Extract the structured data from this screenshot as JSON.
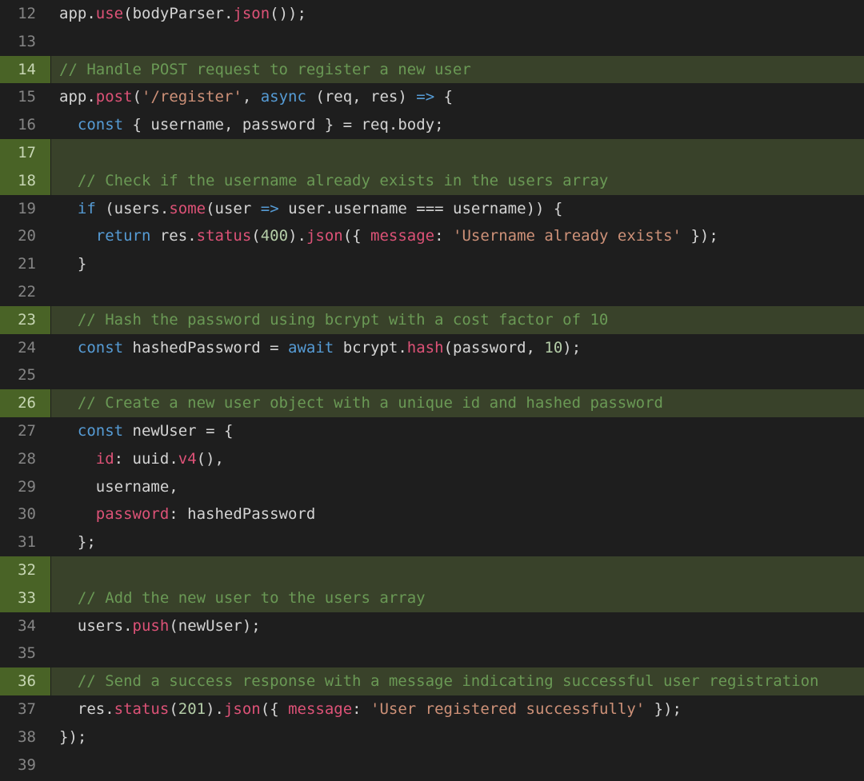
{
  "startLine": 12,
  "highlightLines": [
    14,
    17,
    18,
    23,
    26,
    32,
    33,
    36
  ],
  "lines": [
    {
      "n": 12,
      "tokens": [
        {
          "t": "app",
          "c": "tk-ident"
        },
        {
          "t": ".",
          "c": "tk-punc"
        },
        {
          "t": "use",
          "c": "tk-method"
        },
        {
          "t": "(",
          "c": "tk-punc"
        },
        {
          "t": "bodyParser",
          "c": "tk-ident"
        },
        {
          "t": ".",
          "c": "tk-punc"
        },
        {
          "t": "json",
          "c": "tk-method"
        },
        {
          "t": "());",
          "c": "tk-punc"
        }
      ]
    },
    {
      "n": 13,
      "tokens": []
    },
    {
      "n": 14,
      "tokens": [
        {
          "t": "// Handle POST request to register a new user",
          "c": "tk-comment"
        }
      ]
    },
    {
      "n": 15,
      "tokens": [
        {
          "t": "app",
          "c": "tk-ident"
        },
        {
          "t": ".",
          "c": "tk-punc"
        },
        {
          "t": "post",
          "c": "tk-method"
        },
        {
          "t": "(",
          "c": "tk-punc"
        },
        {
          "t": "'/register'",
          "c": "tk-string"
        },
        {
          "t": ", ",
          "c": "tk-punc"
        },
        {
          "t": "async",
          "c": "tk-kw"
        },
        {
          "t": " (",
          "c": "tk-punc"
        },
        {
          "t": "req",
          "c": "tk-ident"
        },
        {
          "t": ", ",
          "c": "tk-punc"
        },
        {
          "t": "res",
          "c": "tk-ident"
        },
        {
          "t": ") ",
          "c": "tk-punc"
        },
        {
          "t": "=>",
          "c": "tk-arrow"
        },
        {
          "t": " {",
          "c": "tk-punc"
        }
      ]
    },
    {
      "n": 16,
      "indent": 1,
      "tokens": [
        {
          "t": "const",
          "c": "tk-kw"
        },
        {
          "t": " { ",
          "c": "tk-punc"
        },
        {
          "t": "username",
          "c": "tk-ident"
        },
        {
          "t": ", ",
          "c": "tk-punc"
        },
        {
          "t": "password",
          "c": "tk-ident"
        },
        {
          "t": " } = ",
          "c": "tk-punc"
        },
        {
          "t": "req",
          "c": "tk-ident"
        },
        {
          "t": ".",
          "c": "tk-punc"
        },
        {
          "t": "body",
          "c": "tk-ident"
        },
        {
          "t": ";",
          "c": "tk-punc"
        }
      ]
    },
    {
      "n": 17,
      "tokens": []
    },
    {
      "n": 18,
      "indent": 1,
      "tokens": [
        {
          "t": "// Check if the username already exists in the users array",
          "c": "tk-comment"
        }
      ]
    },
    {
      "n": 19,
      "indent": 1,
      "tokens": [
        {
          "t": "if",
          "c": "tk-kw"
        },
        {
          "t": " (",
          "c": "tk-punc"
        },
        {
          "t": "users",
          "c": "tk-ident"
        },
        {
          "t": ".",
          "c": "tk-punc"
        },
        {
          "t": "some",
          "c": "tk-method"
        },
        {
          "t": "(",
          "c": "tk-punc"
        },
        {
          "t": "user",
          "c": "tk-ident"
        },
        {
          "t": " ",
          "c": "tk-punc"
        },
        {
          "t": "=>",
          "c": "tk-arrow"
        },
        {
          "t": " ",
          "c": "tk-punc"
        },
        {
          "t": "user",
          "c": "tk-ident"
        },
        {
          "t": ".",
          "c": "tk-punc"
        },
        {
          "t": "username",
          "c": "tk-ident"
        },
        {
          "t": " === ",
          "c": "tk-op"
        },
        {
          "t": "username",
          "c": "tk-ident"
        },
        {
          "t": ")) {",
          "c": "tk-punc"
        }
      ]
    },
    {
      "n": 20,
      "indent": 2,
      "tokens": [
        {
          "t": "return",
          "c": "tk-kw"
        },
        {
          "t": " ",
          "c": "tk-punc"
        },
        {
          "t": "res",
          "c": "tk-ident"
        },
        {
          "t": ".",
          "c": "tk-punc"
        },
        {
          "t": "status",
          "c": "tk-method"
        },
        {
          "t": "(",
          "c": "tk-punc"
        },
        {
          "t": "400",
          "c": "tk-num"
        },
        {
          "t": ").",
          "c": "tk-punc"
        },
        {
          "t": "json",
          "c": "tk-method"
        },
        {
          "t": "({ ",
          "c": "tk-punc"
        },
        {
          "t": "message",
          "c": "tk-prop"
        },
        {
          "t": ": ",
          "c": "tk-punc"
        },
        {
          "t": "'Username already exists'",
          "c": "tk-string"
        },
        {
          "t": " });",
          "c": "tk-punc"
        }
      ]
    },
    {
      "n": 21,
      "indent": 1,
      "tokens": [
        {
          "t": "}",
          "c": "tk-punc"
        }
      ]
    },
    {
      "n": 22,
      "tokens": []
    },
    {
      "n": 23,
      "indent": 1,
      "tokens": [
        {
          "t": "// Hash the password using bcrypt with a cost factor of 10",
          "c": "tk-comment"
        }
      ]
    },
    {
      "n": 24,
      "indent": 1,
      "tokens": [
        {
          "t": "const",
          "c": "tk-kw"
        },
        {
          "t": " ",
          "c": "tk-punc"
        },
        {
          "t": "hashedPassword",
          "c": "tk-ident"
        },
        {
          "t": " = ",
          "c": "tk-punc"
        },
        {
          "t": "await",
          "c": "tk-kw"
        },
        {
          "t": " ",
          "c": "tk-punc"
        },
        {
          "t": "bcrypt",
          "c": "tk-ident"
        },
        {
          "t": ".",
          "c": "tk-punc"
        },
        {
          "t": "hash",
          "c": "tk-method"
        },
        {
          "t": "(",
          "c": "tk-punc"
        },
        {
          "t": "password",
          "c": "tk-ident"
        },
        {
          "t": ", ",
          "c": "tk-punc"
        },
        {
          "t": "10",
          "c": "tk-num"
        },
        {
          "t": ");",
          "c": "tk-punc"
        }
      ]
    },
    {
      "n": 25,
      "tokens": []
    },
    {
      "n": 26,
      "indent": 1,
      "tokens": [
        {
          "t": "// Create a new user object with a unique id and hashed password",
          "c": "tk-comment"
        }
      ]
    },
    {
      "n": 27,
      "indent": 1,
      "tokens": [
        {
          "t": "const",
          "c": "tk-kw"
        },
        {
          "t": " ",
          "c": "tk-punc"
        },
        {
          "t": "newUser",
          "c": "tk-ident"
        },
        {
          "t": " = {",
          "c": "tk-punc"
        }
      ]
    },
    {
      "n": 28,
      "indent": 2,
      "tokens": [
        {
          "t": "id",
          "c": "tk-prop"
        },
        {
          "t": ": ",
          "c": "tk-punc"
        },
        {
          "t": "uuid",
          "c": "tk-ident"
        },
        {
          "t": ".",
          "c": "tk-punc"
        },
        {
          "t": "v4",
          "c": "tk-method"
        },
        {
          "t": "(),",
          "c": "tk-punc"
        }
      ]
    },
    {
      "n": 29,
      "indent": 2,
      "tokens": [
        {
          "t": "username",
          "c": "tk-ident"
        },
        {
          "t": ",",
          "c": "tk-punc"
        }
      ]
    },
    {
      "n": 30,
      "indent": 2,
      "tokens": [
        {
          "t": "password",
          "c": "tk-prop"
        },
        {
          "t": ": ",
          "c": "tk-punc"
        },
        {
          "t": "hashedPassword",
          "c": "tk-ident"
        }
      ]
    },
    {
      "n": 31,
      "indent": 1,
      "tokens": [
        {
          "t": "};",
          "c": "tk-punc"
        }
      ]
    },
    {
      "n": 32,
      "tokens": []
    },
    {
      "n": 33,
      "indent": 1,
      "tokens": [
        {
          "t": "// Add the new user to the users array",
          "c": "tk-comment"
        }
      ]
    },
    {
      "n": 34,
      "indent": 1,
      "tokens": [
        {
          "t": "users",
          "c": "tk-ident"
        },
        {
          "t": ".",
          "c": "tk-punc"
        },
        {
          "t": "push",
          "c": "tk-method"
        },
        {
          "t": "(",
          "c": "tk-punc"
        },
        {
          "t": "newUser",
          "c": "tk-ident"
        },
        {
          "t": ");",
          "c": "tk-punc"
        }
      ]
    },
    {
      "n": 35,
      "tokens": []
    },
    {
      "n": 36,
      "indent": 1,
      "tokens": [
        {
          "t": "// Send a success response with a message indicating successful user registration",
          "c": "tk-comment"
        }
      ]
    },
    {
      "n": 37,
      "indent": 1,
      "tokens": [
        {
          "t": "res",
          "c": "tk-ident"
        },
        {
          "t": ".",
          "c": "tk-punc"
        },
        {
          "t": "status",
          "c": "tk-method"
        },
        {
          "t": "(",
          "c": "tk-punc"
        },
        {
          "t": "201",
          "c": "tk-num"
        },
        {
          "t": ").",
          "c": "tk-punc"
        },
        {
          "t": "json",
          "c": "tk-method"
        },
        {
          "t": "({ ",
          "c": "tk-punc"
        },
        {
          "t": "message",
          "c": "tk-prop"
        },
        {
          "t": ": ",
          "c": "tk-punc"
        },
        {
          "t": "'User registered successfully'",
          "c": "tk-string"
        },
        {
          "t": " });",
          "c": "tk-punc"
        }
      ]
    },
    {
      "n": 38,
      "tokens": [
        {
          "t": "});",
          "c": "tk-punc"
        }
      ]
    },
    {
      "n": 39,
      "tokens": []
    }
  ]
}
